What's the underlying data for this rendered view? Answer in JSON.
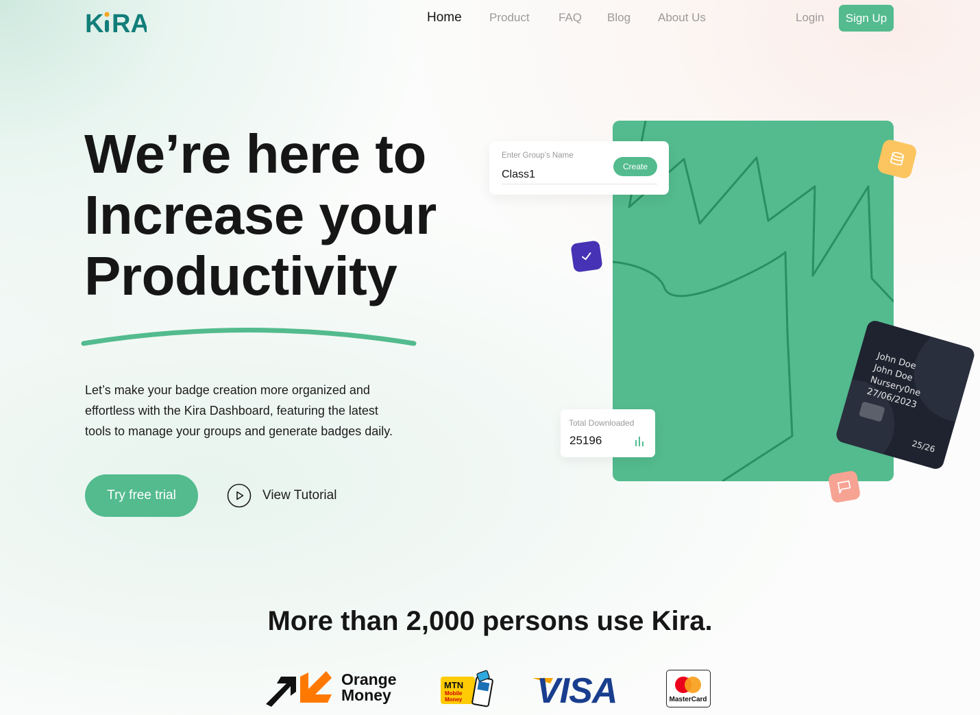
{
  "brand": {
    "logo_text": "KiRA",
    "accent": "#53bb8e"
  },
  "nav": {
    "items": [
      "Home",
      "Product",
      "FAQ",
      "Blog",
      "About Us"
    ],
    "login": "Login",
    "signup": "Sign Up"
  },
  "hero": {
    "title_line1": "We’re here to",
    "title_line2": "Increase your",
    "title_line3": "Productivity",
    "description": "Let’s make your badge creation more organized and effortless with the Kira Dashboard, featuring the latest tools to manage your groups and generate badges daily.",
    "cta_primary": "Try free trial",
    "cta_secondary": "View Tutorial"
  },
  "group_card": {
    "label": "Enter Group’s Name",
    "value": "Class1",
    "button": "Create"
  },
  "download_card": {
    "label": "Total Downloaded",
    "value": "25196"
  },
  "id_card": {
    "line1": "John Doe",
    "line2": "John Doe",
    "line3": "Nursery0ne",
    "line4": "27/06/2023",
    "number": "25/26"
  },
  "users": {
    "title": "More than 2,000 persons use Kira.",
    "partners": [
      {
        "name": "Orange Money",
        "line1": "Orange",
        "line2": "Money"
      },
      {
        "name": "MTN Mobile Money",
        "line1": "MTN",
        "line2": "Mobile",
        "line3": "Money"
      },
      {
        "name": "VISA",
        "text": "VISA"
      },
      {
        "name": "MasterCard",
        "text": "MasterCard"
      }
    ]
  },
  "icons": [
    "play-icon",
    "check-icon",
    "coin-stack-icon",
    "flag-icon",
    "bar-chart-icon"
  ]
}
